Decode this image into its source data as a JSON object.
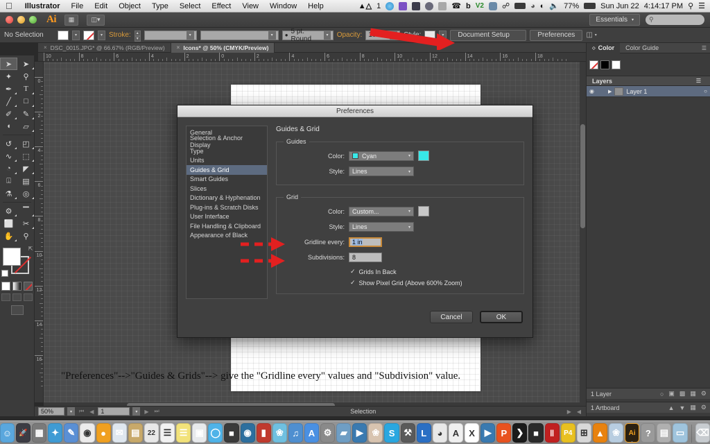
{
  "mac_menubar": {
    "apple_icon": "apple-icon",
    "items": [
      {
        "label": "Illustrator",
        "bold": true
      },
      {
        "label": "File",
        "bold": false
      },
      {
        "label": "Edit",
        "bold": false
      },
      {
        "label": "Object",
        "bold": false
      },
      {
        "label": "Type",
        "bold": false
      },
      {
        "label": "Select",
        "bold": false
      },
      {
        "label": "Effect",
        "bold": false
      },
      {
        "label": "View",
        "bold": false
      },
      {
        "label": "Window",
        "bold": false
      },
      {
        "label": "Help",
        "bold": false
      }
    ],
    "status": {
      "input_source": "1",
      "battery_percent": "77%",
      "date": "Sun Jun 22",
      "time": "4:14:17 PM",
      "icons": [
        "airplay-icon",
        "dropbox-icon",
        "vpn-icon",
        "shield-icon",
        "umbrella-icon",
        "bell-icon",
        "phone-icon",
        "bluetooth-icon",
        "battery-icon",
        "clock-icon",
        "wifi-icon",
        "volume-icon",
        "spotlight-icon",
        "notification-center-icon"
      ]
    }
  },
  "app_titlebar": {
    "app_logo": "Ai",
    "bridge_icon": "bridge-icon",
    "arrange_icon": "arrange-documents-icon",
    "workspace": "Essentials",
    "search_placeholder": ""
  },
  "control_bar": {
    "selection_status": "No Selection",
    "fill_swatch": "fill-swatch",
    "stroke_swatch": "stroke-none-swatch",
    "stroke_label": "Stroke:",
    "stroke_weight": "",
    "stroke_profile": "",
    "brush_label": "5 pt. Round",
    "opacity_label": "Opacity:",
    "opacity_value": "100%",
    "style_label": "Style:",
    "document_setup_label": "Document Setup",
    "preferences_label": "Preferences",
    "align_icon": "align-icon"
  },
  "doc_tabs": [
    {
      "title": "DSC_0015.JPG* @ 66.67% (RGB/Preview)",
      "active": false
    },
    {
      "title": "Icons* @ 50% (CMYK/Preview)",
      "active": true
    }
  ],
  "toolbar": {
    "tools": [
      {
        "name": "selection-tool",
        "glyph": "➤",
        "selected": true
      },
      {
        "name": "direct-selection-tool",
        "glyph": "➤",
        "selected": false
      },
      {
        "name": "magic-wand-tool",
        "glyph": "✦",
        "selected": false
      },
      {
        "name": "lasso-tool",
        "glyph": "☁",
        "selected": false
      },
      {
        "name": "pen-tool",
        "glyph": "✒",
        "selected": false
      },
      {
        "name": "type-tool",
        "glyph": "T",
        "selected": false
      },
      {
        "name": "line-segment-tool",
        "glyph": "╱",
        "selected": false
      },
      {
        "name": "rectangle-tool",
        "glyph": "■",
        "selected": false
      },
      {
        "name": "paintbrush-tool",
        "glyph": "✐",
        "selected": false
      },
      {
        "name": "pencil-tool",
        "glyph": "✏",
        "selected": false
      },
      {
        "name": "blob-brush-tool",
        "glyph": "◖",
        "selected": false
      },
      {
        "name": "eraser-tool",
        "glyph": "▱",
        "selected": false
      },
      {
        "name": "rotate-tool",
        "glyph": "↺",
        "selected": false
      },
      {
        "name": "scale-tool",
        "glyph": "◰",
        "selected": false
      },
      {
        "name": "width-tool",
        "glyph": "∿",
        "selected": false
      },
      {
        "name": "free-transform-tool",
        "glyph": "⬚",
        "selected": false
      },
      {
        "name": "shape-builder-tool",
        "glyph": "◔",
        "selected": false
      },
      {
        "name": "perspective-grid-tool",
        "glyph": "◤",
        "selected": false
      },
      {
        "name": "mesh-tool",
        "glyph": "⌗",
        "selected": false
      },
      {
        "name": "gradient-tool",
        "glyph": "▤",
        "selected": false
      },
      {
        "name": "eyedropper-tool",
        "glyph": "⚗",
        "selected": false
      },
      {
        "name": "blend-tool",
        "glyph": "◎",
        "selected": false
      },
      {
        "name": "symbol-sprayer-tool",
        "glyph": "⚙",
        "selected": false
      },
      {
        "name": "column-graph-tool",
        "glyph": "▐",
        "selected": false
      },
      {
        "name": "artboard-tool",
        "glyph": "⬜",
        "selected": false
      },
      {
        "name": "slice-tool",
        "glyph": "✂",
        "selected": false
      },
      {
        "name": "hand-tool",
        "glyph": "✋",
        "selected": false
      },
      {
        "name": "zoom-tool",
        "glyph": "⚲",
        "selected": false
      }
    ]
  },
  "rulers": {
    "unit": "in",
    "horizontal_labels": [
      "10",
      "8",
      "6",
      "4",
      "2",
      "0",
      "2",
      "4",
      "6",
      "8",
      "10",
      "12",
      "14",
      "16",
      "18"
    ],
    "vertical_labels": [
      "0",
      "2",
      "4",
      "6",
      "8",
      "10",
      "12",
      "14",
      "16"
    ]
  },
  "canvas": {
    "caption": "\"Preferences\"-->\"Guides & Grids\"--> give the \"Gridline every\" values and \"Subdivision\" value."
  },
  "status_bar": {
    "zoom": "50%",
    "page": "1",
    "tool_status": "Selection"
  },
  "right_dock": {
    "color_panel": {
      "tabs": [
        {
          "label": "Color",
          "active": true
        },
        {
          "label": "Color Guide",
          "active": false
        }
      ],
      "swatches": [
        "none-swatch",
        "black-swatch",
        "white-swatch"
      ]
    },
    "layers_panel": {
      "title": "Layers",
      "rows": [
        {
          "name": "Layer 1",
          "visible": true,
          "locked": false
        }
      ],
      "footer_count": "1 Layer",
      "footer_icons": [
        "locate-object-icon",
        "make-mask-icon",
        "new-sublayer-icon",
        "new-layer-icon",
        "delete-layer-icon"
      ]
    },
    "artboards_panel": {
      "footer_count": "1 Artboard",
      "footer_icons": [
        "move-up-icon",
        "move-down-icon",
        "new-artboard-icon",
        "delete-artboard-icon"
      ]
    }
  },
  "prefs_dialog": {
    "title": "Preferences",
    "categories": [
      {
        "label": "General",
        "selected": false
      },
      {
        "label": "Selection & Anchor Display",
        "selected": false
      },
      {
        "label": "Type",
        "selected": false
      },
      {
        "label": "Units",
        "selected": false
      },
      {
        "label": "Guides & Grid",
        "selected": true
      },
      {
        "label": "Smart Guides",
        "selected": false
      },
      {
        "label": "Slices",
        "selected": false
      },
      {
        "label": "Dictionary & Hyphenation",
        "selected": false
      },
      {
        "label": "Plug-ins & Scratch Disks",
        "selected": false
      },
      {
        "label": "User Interface",
        "selected": false
      },
      {
        "label": "File Handling & Clipboard",
        "selected": false
      },
      {
        "label": "Appearance of Black",
        "selected": false
      }
    ],
    "section_title": "Guides & Grid",
    "guides": {
      "legend": "Guides",
      "color_label": "Color:",
      "color_value": "Cyan",
      "color_hex": "#38e8e8",
      "style_label": "Style:",
      "style_value": "Lines"
    },
    "grid": {
      "legend": "Grid",
      "color_label": "Color:",
      "color_value": "Custom...",
      "color_hex": "#c8c8c8",
      "style_label": "Style:",
      "style_value": "Lines",
      "gridline_every_label": "Gridline every:",
      "gridline_every_value": "1 in",
      "subdivisions_label": "Subdivisions:",
      "subdivisions_value": "8",
      "grids_in_back_label": "Grids In Back",
      "grids_in_back_checked": true,
      "show_pixel_grid_label": "Show Pixel Grid (Above 600% Zoom)",
      "show_pixel_grid_checked": true
    },
    "cancel_label": "Cancel",
    "ok_label": "OK",
    "annotation_color": "#e32020"
  },
  "dock": {
    "icons": [
      {
        "name": "finder-icon",
        "color": "#5aa7dd",
        "glyph": "☺"
      },
      {
        "name": "launchpad-icon",
        "color": "#3c3c44",
        "glyph": "🚀"
      },
      {
        "name": "mission-control-icon",
        "color": "#7a7a7a",
        "glyph": "▦"
      },
      {
        "name": "safari-icon",
        "color": "#3f9bd4",
        "glyph": "✦"
      },
      {
        "name": "notes-blue-icon",
        "color": "#5a8fd4",
        "glyph": "✎"
      },
      {
        "name": "chrome-icon",
        "color": "#ecebeb",
        "glyph": "◉"
      },
      {
        "name": "firefox-icon",
        "color": "#f0a020",
        "glyph": "●"
      },
      {
        "name": "mail-icon",
        "color": "#dfe7ef",
        "glyph": "✉"
      },
      {
        "name": "contacts-icon",
        "color": "#c8a96a",
        "glyph": "▤"
      },
      {
        "name": "calendar-icon",
        "color": "#e8e8e8",
        "glyph": "22"
      },
      {
        "name": "reminders-icon",
        "color": "#f2f2f2",
        "glyph": "☰"
      },
      {
        "name": "notes-icon",
        "color": "#f2e27a",
        "glyph": "☰"
      },
      {
        "name": "app-store-yellow-icon",
        "color": "#e8eaec",
        "glyph": "▣"
      },
      {
        "name": "messages-icon",
        "color": "#4fb3e8",
        "glyph": "◯"
      },
      {
        "name": "facetime-icon",
        "color": "#3a3a3a",
        "glyph": "■"
      },
      {
        "name": "itunes-dvd-icon",
        "color": "#2d6f9e",
        "glyph": "◉"
      },
      {
        "name": "ibooks-icon",
        "color": "#c03a2e",
        "glyph": "▮"
      },
      {
        "name": "photos-icon",
        "color": "#6fc0e0",
        "glyph": "❀"
      },
      {
        "name": "itunes-icon",
        "color": "#4f8fd0",
        "glyph": "♫"
      },
      {
        "name": "app-store-icon",
        "color": "#4a90e2",
        "glyph": "A"
      },
      {
        "name": "system-preferences-icon",
        "color": "#8a8a8a",
        "glyph": "⚙"
      },
      {
        "name": "truck-icon",
        "color": "#6f9ec4",
        "glyph": "▰"
      },
      {
        "name": "quicktime-icon",
        "color": "#3a7ab0",
        "glyph": "▶"
      },
      {
        "name": "popcorn-time-icon",
        "color": "#d8c4b0",
        "glyph": "❀"
      },
      {
        "name": "skype-icon",
        "color": "#2aa7e0",
        "glyph": "S"
      },
      {
        "name": "cleaner-icon",
        "color": "#5a5a5a",
        "glyph": "⚒"
      },
      {
        "name": "lync-icon",
        "color": "#2a6fc4",
        "glyph": "L"
      },
      {
        "name": "keynote-icon",
        "color": "#e8e8e8",
        "glyph": "◕"
      },
      {
        "name": "acrobat-icon",
        "color": "#f0f0f0",
        "glyph": "A"
      },
      {
        "name": "excel-icon",
        "color": "#ffffff",
        "glyph": "X"
      },
      {
        "name": "quicktime-player-icon",
        "color": "#3a7ab0",
        "glyph": "▶"
      },
      {
        "name": "photoshop-p-icon",
        "color": "#e8521f",
        "glyph": "P"
      },
      {
        "name": "terminal-icon",
        "color": "#1a1a1a",
        "glyph": "❯"
      },
      {
        "name": "screen-icon",
        "color": "#2a2a2a",
        "glyph": "■"
      },
      {
        "name": "red-books-icon",
        "color": "#c02020",
        "glyph": "‖"
      },
      {
        "name": "p4-icon",
        "color": "#e8c020",
        "glyph": "P4"
      },
      {
        "name": "calculator-icon",
        "color": "#d8d8d8",
        "glyph": "⊞"
      },
      {
        "name": "vlc-icon",
        "color": "#e8820f",
        "glyph": "▲"
      },
      {
        "name": "preview-icon",
        "color": "#b8cde0",
        "glyph": "❀"
      },
      {
        "name": "illustrator-icon",
        "color": "#2b2112",
        "glyph": "Ai",
        "active": true
      },
      {
        "name": "help-icon",
        "color": "#9a9a9a",
        "glyph": "?"
      },
      {
        "name": "downloads-stack-icon",
        "color": "#b0b0b0",
        "glyph": "▤"
      },
      {
        "name": "documents-folder-icon",
        "color": "#9fc4dd",
        "glyph": "▭"
      },
      {
        "name": "trash-icon",
        "color": "#c8ccd0",
        "glyph": "⌫"
      }
    ]
  }
}
